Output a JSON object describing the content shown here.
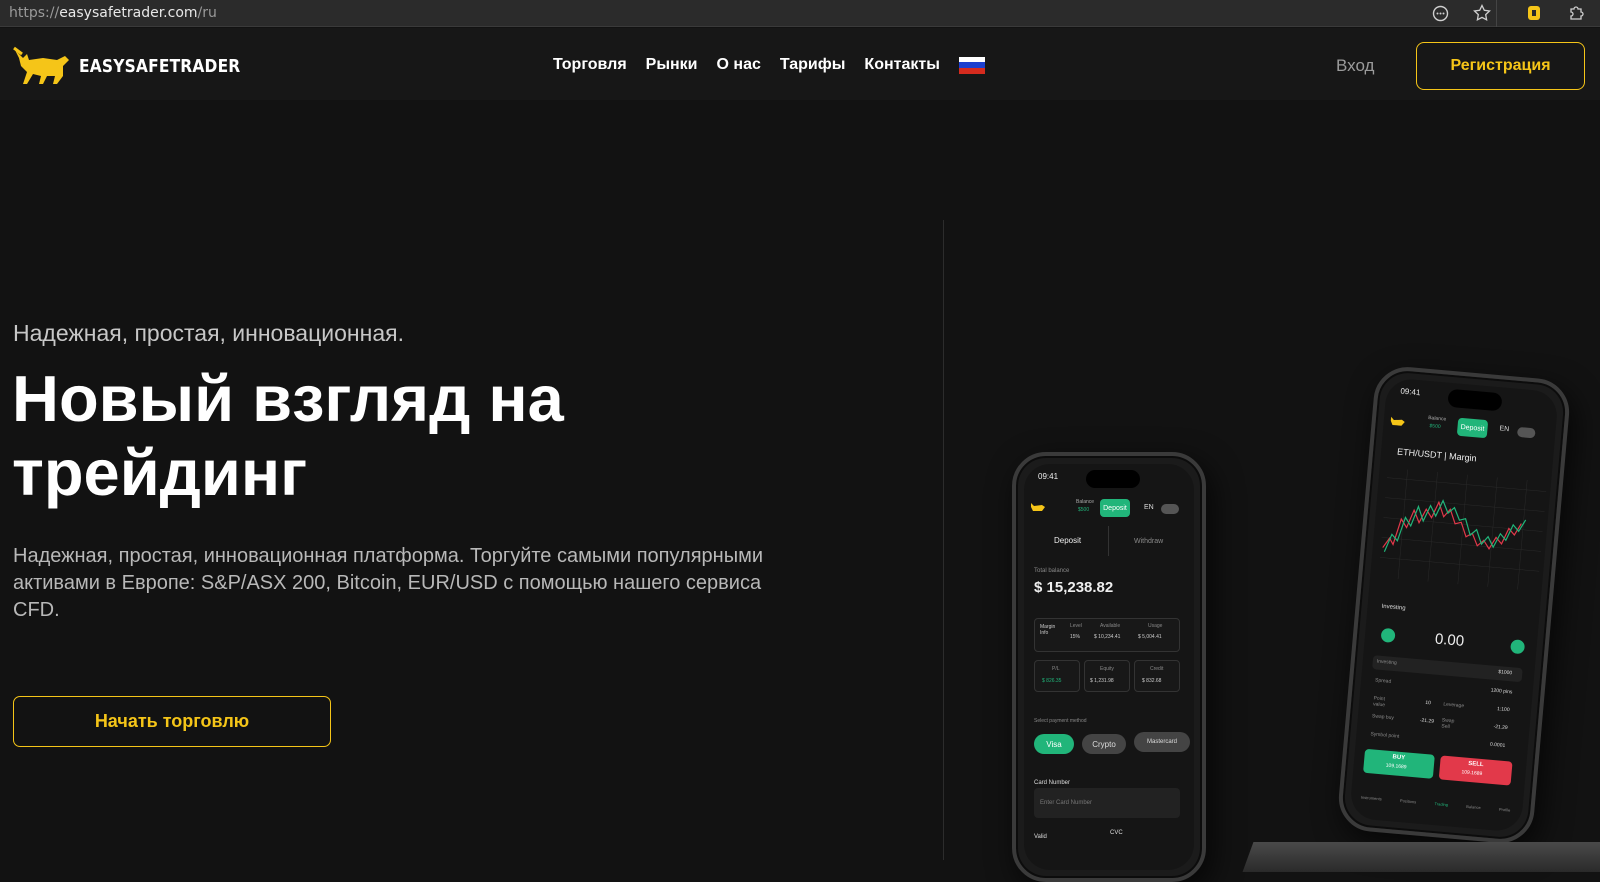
{
  "browser": {
    "url_prefix": "https://",
    "url_host": "easysafetrader.com",
    "url_path": "/ru"
  },
  "header": {
    "logo_text": "EASYSAFETRADER",
    "nav": [
      "Торговля",
      "Рынки",
      "О нас",
      "Тарифы",
      "Контакты"
    ],
    "login": "Вход",
    "register": "Регистрация"
  },
  "hero": {
    "subtitle": "Надежная, простая, инновационная.",
    "title_line1": "Новый взгляд на",
    "title_line2": "трейдинг",
    "description": "Надежная, простая, инновационная платформа. Торгуйте самыми популярными активами в Европе: S&P/ASX 200, Bitcoin, EUR/USD с помощью нашего сервиса CFD.",
    "cta": "Начать торговлю"
  },
  "phone_left": {
    "time": "09:41",
    "balance_label": "Balance",
    "balance_value": "$500",
    "deposit_btn": "Deposit",
    "lang": "EN",
    "tab_deposit": "Deposit",
    "tab_withdraw": "Withdraw",
    "total_balance_label": "Total balance",
    "total_balance": "$ 15,238.82",
    "margin_label": "Margin Info",
    "level_label": "Level",
    "level_value": "15%",
    "available_label": "Available",
    "available_value": "$ 10,234.41",
    "usage_label": "Usage",
    "usage_value": "$ 5,004.41",
    "pl_label": "P/L",
    "pl_value": "$ 826.35",
    "equity_label": "Equity",
    "equity_value": "$ 1,231.98",
    "credit_label": "Credit",
    "credit_value": "$ 832.68",
    "payment_label": "Select payment method",
    "pay_visa": "Visa",
    "pay_crypto": "Crypto",
    "pay_mastercard": "Mastercard",
    "card_number_label": "Card Number",
    "card_number_placeholder": "Enter Card Number",
    "valid_label": "Valid",
    "cvc_label": "CVC"
  },
  "phone_right": {
    "time": "09:41",
    "balance_label": "Balance",
    "balance_value": "$500",
    "deposit_btn": "Deposit",
    "lang": "EN",
    "pair": "ETH/USDT | Margin",
    "investing_label": "Investing",
    "amount": "0.00",
    "investing_row": "Investing",
    "investing_value": "$1000",
    "spread_label": "Spread",
    "spread_value": "1200 pins",
    "point_label": "Point value",
    "point_value": "10",
    "leverage_label": "Leverage",
    "leverage_value": "1:100",
    "swapbuy_label": "Swap buy",
    "swapbuy_value": "-21.29",
    "swapsell_label": "Swap Sell",
    "swapsell_value": "-21.29",
    "symbol_label": "Symbol point",
    "symbol_value": "0.0001",
    "buy_label": "BUY",
    "buy_value": "109.1689",
    "sell_label": "SELL",
    "sell_value": "109.1689",
    "tabs": [
      "Instruments",
      "Positions",
      "Trading",
      "Balance",
      "Profile"
    ]
  },
  "colors": {
    "accent": "#f5c518",
    "background": "#121212",
    "green": "#21b57a",
    "red": "#e2394a"
  }
}
